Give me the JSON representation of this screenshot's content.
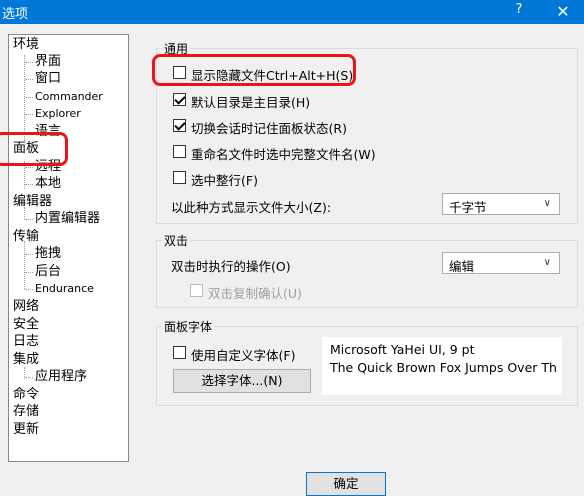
{
  "window": {
    "title": "选项",
    "help_glyph": "?",
    "close_glyph": "✕"
  },
  "tree": {
    "items": [
      {
        "label": "环境",
        "level": 0
      },
      {
        "label": "界面",
        "level": 1
      },
      {
        "label": "窗口",
        "level": 1
      },
      {
        "label": "Commander",
        "level": 1
      },
      {
        "label": "Explorer",
        "level": 1
      },
      {
        "label": "语言",
        "level": 1
      },
      {
        "label": "面板",
        "level": 0,
        "selected": true
      },
      {
        "label": "远程",
        "level": 1
      },
      {
        "label": "本地",
        "level": 1
      },
      {
        "label": "编辑器",
        "level": 0
      },
      {
        "label": "内置编辑器",
        "level": 1
      },
      {
        "label": "传输",
        "level": 0
      },
      {
        "label": "拖拽",
        "level": 1
      },
      {
        "label": "后台",
        "level": 1
      },
      {
        "label": "Endurance",
        "level": 1
      },
      {
        "label": "网络",
        "level": 0
      },
      {
        "label": "安全",
        "level": 0
      },
      {
        "label": "日志",
        "level": 0
      },
      {
        "label": "集成",
        "level": 0
      },
      {
        "label": "应用程序",
        "level": 1
      },
      {
        "label": "命令",
        "level": 0
      },
      {
        "label": "存储",
        "level": 0
      },
      {
        "label": "更新",
        "level": 0
      }
    ]
  },
  "general": {
    "title": "通用",
    "show_hidden": {
      "label": "显示隐藏文件Ctrl+Alt+H(S)",
      "checked": false
    },
    "default_dir_home": {
      "label": "默认目录是主目录(H)",
      "checked": true
    },
    "remember_panel_state": {
      "label": "切换会话时记住面板状态(R)",
      "checked": true
    },
    "select_full_name_on_rename": {
      "label": "重命名文件时选中完整文件名(W)",
      "checked": false
    },
    "select_full_row": {
      "label": "选中整行(F)",
      "checked": false
    },
    "file_size_label": "以此种方式显示文件大小(Z):",
    "file_size_value": "千字节"
  },
  "double_click": {
    "title": "双击",
    "action_label": "双击时执行的操作(O)",
    "action_value": "编辑",
    "confirm_copy": {
      "label": "双击复制确认(U)",
      "checked": false,
      "disabled": true
    }
  },
  "panel_font": {
    "title": "面板字体",
    "use_custom": {
      "label": "使用自定义字体(F)",
      "checked": false
    },
    "choose_button": "选择字体...(N)",
    "preview_line1": "Microsoft YaHei UI, 9 pt",
    "preview_line2": "The Quick Brown Fox Jumps Over Th"
  },
  "footer": {
    "ok_button": "确定"
  },
  "colors": {
    "titlebar": "#0078d7",
    "highlight": "#e8151b",
    "window_bg": "#f0f0f0"
  }
}
